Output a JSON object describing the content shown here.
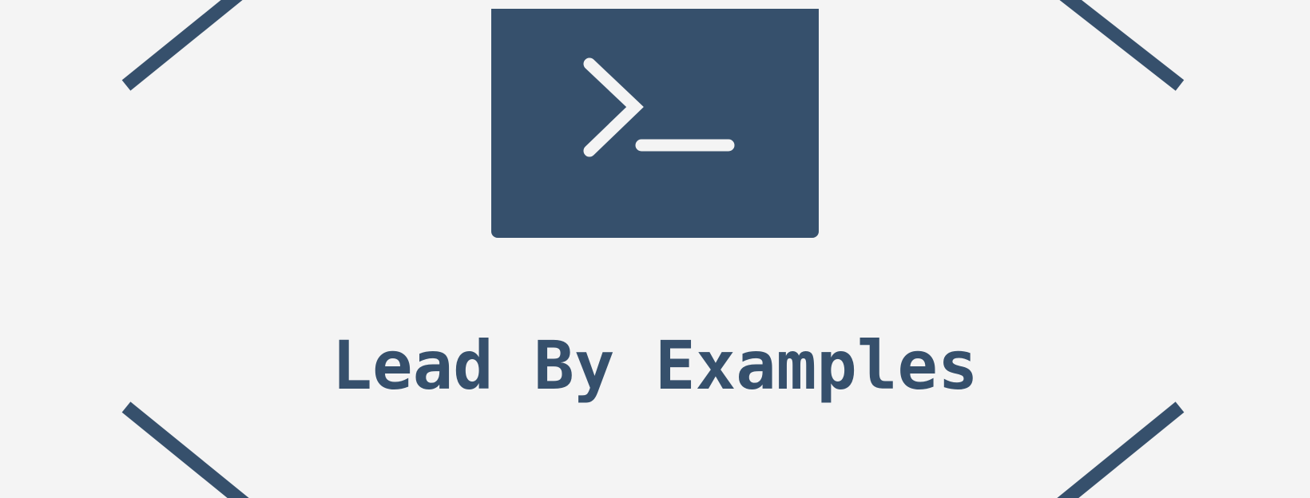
{
  "tagline": "Lead By Examples",
  "icon": {
    "name": "terminal-prompt-icon",
    "glyph": ">_"
  },
  "colors": {
    "background": "#f4f4f4",
    "primary": "#36506c",
    "icon_glyph": "#f4f4f4"
  }
}
